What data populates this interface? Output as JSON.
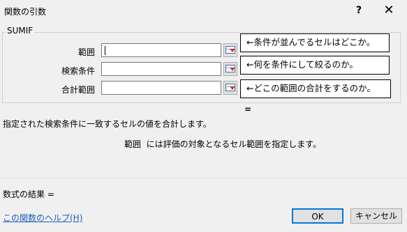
{
  "window": {
    "title": "関数の引数",
    "help_label": "?",
    "close_label": "✕"
  },
  "function": {
    "name": "SUMIF"
  },
  "args": [
    {
      "label": "範囲",
      "value": ""
    },
    {
      "label": "検索条件",
      "value": ""
    },
    {
      "label": "合計範囲",
      "value": ""
    }
  ],
  "notes": [
    "←条件が並んでるセルはどこか。",
    "←何を条件にして絞るのか。",
    "←どこの範囲の合計をするのか。"
  ],
  "equals_label": "=",
  "description": "指定された検索条件に一致するセルの値を合計します。",
  "arg_description": {
    "name": "範囲",
    "text": "には評価の対象となるセル範囲を指定します。"
  },
  "result_label": "数式の結果 =",
  "help_link": "この関数のヘルプ(H)",
  "buttons": {
    "ok": "OK",
    "cancel": "キャンセル"
  },
  "icons": {
    "ref_button": "collapse-dialog-icon"
  }
}
